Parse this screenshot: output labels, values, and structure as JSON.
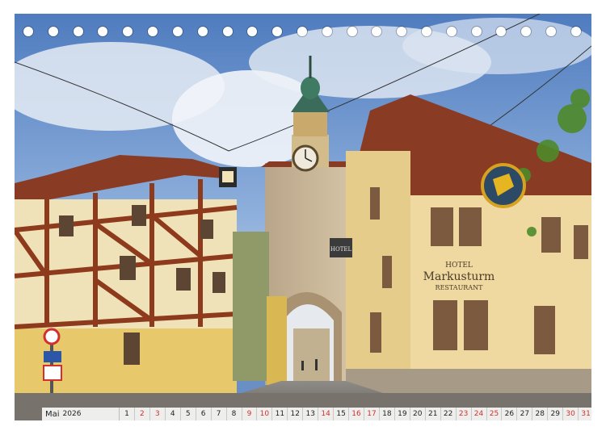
{
  "signs": {
    "hotel_word": "HOTEL",
    "hotel_name": "Markusturm",
    "restaurant_word": "RESTAURANT",
    "hanging_sign": "HOTEL"
  },
  "calendar": {
    "month_label": "Mai",
    "year_label": "2026",
    "days": [
      {
        "n": "1",
        "weekend": false
      },
      {
        "n": "2",
        "weekend": true
      },
      {
        "n": "3",
        "weekend": true
      },
      {
        "n": "4",
        "weekend": false
      },
      {
        "n": "5",
        "weekend": false
      },
      {
        "n": "6",
        "weekend": false
      },
      {
        "n": "7",
        "weekend": false
      },
      {
        "n": "8",
        "weekend": false
      },
      {
        "n": "9",
        "weekend": true
      },
      {
        "n": "10",
        "weekend": true
      },
      {
        "n": "11",
        "weekend": false
      },
      {
        "n": "12",
        "weekend": false
      },
      {
        "n": "13",
        "weekend": false
      },
      {
        "n": "14",
        "weekend": true
      },
      {
        "n": "15",
        "weekend": false
      },
      {
        "n": "16",
        "weekend": true
      },
      {
        "n": "17",
        "weekend": true
      },
      {
        "n": "18",
        "weekend": false
      },
      {
        "n": "19",
        "weekend": false
      },
      {
        "n": "20",
        "weekend": false
      },
      {
        "n": "21",
        "weekend": false
      },
      {
        "n": "22",
        "weekend": false
      },
      {
        "n": "23",
        "weekend": true
      },
      {
        "n": "24",
        "weekend": true
      },
      {
        "n": "25",
        "weekend": true
      },
      {
        "n": "26",
        "weekend": false
      },
      {
        "n": "27",
        "weekend": false
      },
      {
        "n": "28",
        "weekend": false
      },
      {
        "n": "29",
        "weekend": false
      },
      {
        "n": "30",
        "weekend": true
      },
      {
        "n": "31",
        "weekend": true
      }
    ]
  },
  "colors": {
    "weekend": "#d2302c",
    "timber": "#8e3a1c",
    "facade_yellow": "#e7c86a",
    "hotel_facade": "#efd9a0",
    "roof": "#8a3b24"
  }
}
